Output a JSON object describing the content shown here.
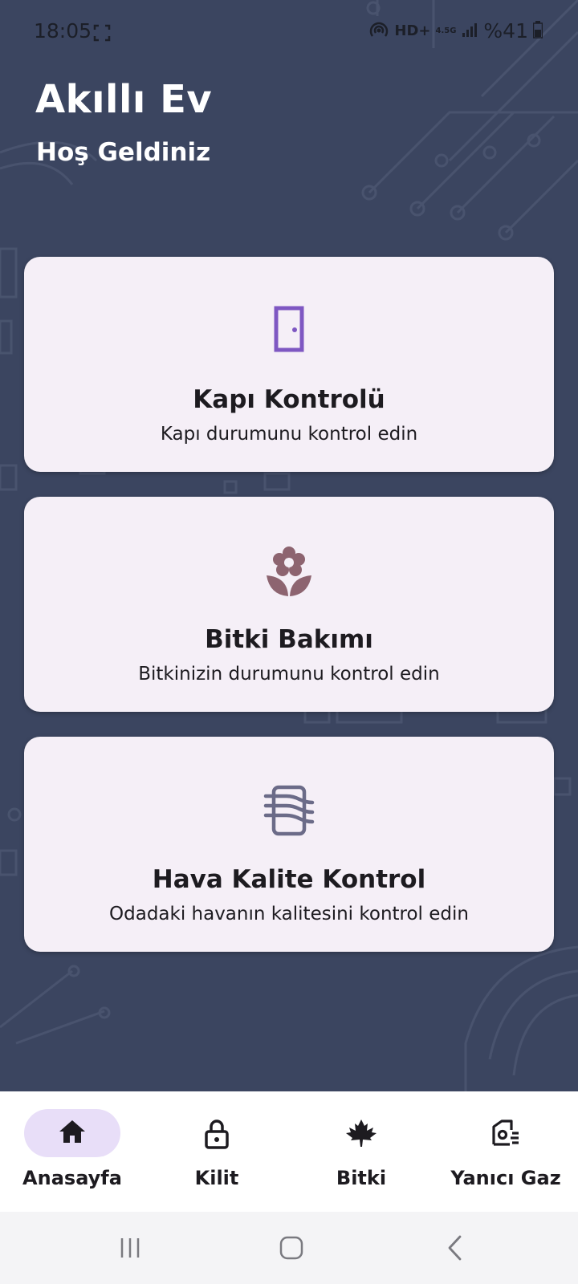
{
  "status_bar": {
    "time": "18:05",
    "network_hd": "HD+",
    "network_gen": "4.5G",
    "battery": "%41"
  },
  "header": {
    "title": "Akıllı Ev",
    "subtitle": "Hoş Geldiniz"
  },
  "cards": [
    {
      "icon": "door-icon",
      "title": "Kapı Kontrolü",
      "description": "Kapı durumunu kontrol edin"
    },
    {
      "icon": "flower-icon",
      "title": "Bitki Bakımı",
      "description": "Bitkinizin durumunu kontrol edin"
    },
    {
      "icon": "air-quality-icon",
      "title": "Hava Kalite Kontrol",
      "description": "Odadaki havanın kalitesini kontrol edin"
    }
  ],
  "bottom_nav": {
    "items": [
      {
        "label": "Anasayfa",
        "icon": "home-icon",
        "active": true
      },
      {
        "label": "Kilit",
        "icon": "lock-icon",
        "active": false
      },
      {
        "label": "Bitki",
        "icon": "leaf-icon",
        "active": false
      },
      {
        "label": "Yanıcı Gaz",
        "icon": "gas-sensor-icon",
        "active": false
      }
    ]
  },
  "colors": {
    "background": "#3b4560",
    "card": "#f5eff7",
    "door_icon": "#7e57c2",
    "flower_icon": "#8d6470",
    "air_icon": "#6b6b88",
    "active_pill": "#e8def8"
  }
}
